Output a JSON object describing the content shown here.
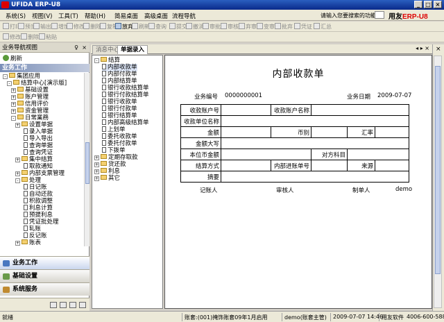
{
  "window": {
    "title": "UFIDA ERP-U8",
    "buttons": {
      "minimize": "_",
      "maximize": "□",
      "close": "×"
    }
  },
  "menubar": {
    "items": [
      "系统(S)",
      "视图(V)",
      "工具(T)",
      "帮助(H)",
      "简易桌面",
      "高级桌面",
      "流程导航"
    ],
    "search_hint": "请输入您要搜索的功能",
    "brand_prefix": "用友",
    "brand_suffix": "ERP-U8"
  },
  "toolbar1": {
    "items": [
      {
        "label": "打印",
        "on": false
      },
      {
        "label": "预览",
        "on": false
      },
      {
        "label": "输出",
        "on": false
      },
      {
        "label": "增加",
        "on": false
      },
      {
        "label": "修改",
        "on": false
      },
      {
        "label": "删除",
        "on": false
      },
      {
        "label": "复制",
        "on": false
      },
      {
        "label": "放弃",
        "on": true
      },
      {
        "label": "刷新",
        "on": false
      },
      {
        "label": "查询",
        "on": false
      },
      {
        "label": "提交",
        "on": false
      },
      {
        "label": "撤消",
        "on": false
      },
      {
        "label": "审批",
        "on": false
      },
      {
        "label": "审核",
        "on": false
      },
      {
        "label": "弃审",
        "on": false
      },
      {
        "label": "变审",
        "on": false
      },
      {
        "label": "批弃",
        "on": false
      },
      {
        "label": "凭证",
        "on": false
      },
      {
        "label": "汇总",
        "on": false
      }
    ]
  },
  "toolbar2": {
    "items": [
      {
        "label": "修改",
        "on": false
      },
      {
        "label": "删除",
        "on": false
      },
      {
        "label": "粘贴",
        "on": false
      }
    ]
  },
  "navpanel": {
    "header": "业务导航视图",
    "pin": "♀",
    "close": "×",
    "refresh_label": "刷新",
    "section_band": "业务工作",
    "tree": [
      {
        "label": "集团应用",
        "exp": "-",
        "fold": true
      },
      {
        "label": "结算中心[演示版]",
        "exp": "-",
        "fold": true
      },
      {
        "label": "基础设置",
        "exp": "+",
        "fold": true
      },
      {
        "label": "账户管理",
        "exp": "+",
        "fold": true
      },
      {
        "label": "信用评价",
        "exp": "+",
        "fold": true
      },
      {
        "label": "资金管理",
        "exp": "+",
        "fold": true
      },
      {
        "label": "日常業務",
        "exp": "-",
        "fold": true
      },
      {
        "label": "设置单据",
        "exp": "+",
        "fold": true
      },
      {
        "label": "录入单据",
        "exp": "",
        "fold": false
      },
      {
        "label": "导入导出",
        "exp": "",
        "fold": false
      },
      {
        "label": "查询单据",
        "exp": "",
        "fold": false
      },
      {
        "label": "查询凭证",
        "exp": "",
        "fold": false
      },
      {
        "label": "集中结算",
        "exp": "+",
        "fold": true
      },
      {
        "label": "取款通知",
        "exp": "",
        "fold": false
      },
      {
        "label": "内部支票管理",
        "exp": "+",
        "fold": true
      },
      {
        "label": "处理",
        "exp": "-",
        "fold": true
      },
      {
        "label": "日记账",
        "exp": "",
        "fold": false
      },
      {
        "label": "自动还款",
        "exp": "",
        "fold": false
      },
      {
        "label": "积款调整",
        "exp": "",
        "fold": false
      },
      {
        "label": "利息计算",
        "exp": "",
        "fold": false
      },
      {
        "label": "预提利息",
        "exp": "",
        "fold": false
      },
      {
        "label": "凭证批处理",
        "exp": "",
        "fold": false
      },
      {
        "label": "轧账",
        "exp": "",
        "fold": false
      },
      {
        "label": "反记账",
        "exp": "",
        "fold": false
      },
      {
        "label": "账表",
        "exp": "+",
        "fold": true
      }
    ],
    "bottom_buttons": [
      "业务工作",
      "基础设置",
      "系统服务"
    ]
  },
  "tabs": {
    "items": [
      "消息中心",
      "单据录入"
    ],
    "active": 1,
    "controls": "◂ ▸ ×"
  },
  "doctree": {
    "items": [
      {
        "label": "结算",
        "exp": "-",
        "fold": true,
        "sel": false
      },
      {
        "label": "内部收款单",
        "exp": "",
        "fold": false,
        "sel": true
      },
      {
        "label": "内部付款单",
        "exp": "",
        "fold": false,
        "sel": false
      },
      {
        "label": "内部结算单",
        "exp": "",
        "fold": false,
        "sel": false
      },
      {
        "label": "银行收款结算单",
        "exp": "",
        "fold": false,
        "sel": false
      },
      {
        "label": "银行付款结算单",
        "exp": "",
        "fold": false,
        "sel": false
      },
      {
        "label": "银行收款单",
        "exp": "",
        "fold": false,
        "sel": false
      },
      {
        "label": "银行付款单",
        "exp": "",
        "fold": false,
        "sel": false
      },
      {
        "label": "银行结算单",
        "exp": "",
        "fold": false,
        "sel": false
      },
      {
        "label": "内部高级结算单",
        "exp": "",
        "fold": false,
        "sel": false
      },
      {
        "label": "上划单",
        "exp": "",
        "fold": false,
        "sel": false
      },
      {
        "label": "委托收款单",
        "exp": "",
        "fold": false,
        "sel": false
      },
      {
        "label": "委托付款单",
        "exp": "",
        "fold": false,
        "sel": false
      },
      {
        "label": "下拨单",
        "exp": "",
        "fold": false,
        "sel": false
      },
      {
        "label": "定期存取款",
        "exp": "+",
        "fold": true,
        "sel": false
      },
      {
        "label": "贷还款",
        "exp": "+",
        "fold": true,
        "sel": false
      },
      {
        "label": "利息",
        "exp": "+",
        "fold": true,
        "sel": false
      },
      {
        "label": "其它",
        "exp": "+",
        "fold": true,
        "sel": false
      }
    ]
  },
  "voucher": {
    "title": "内部收款单",
    "doc_no_label": "业务编号",
    "doc_no_value": "0000000001",
    "date_label": "业务日期",
    "date_value": "2009-07-07",
    "fields": {
      "receive_account": "收款账户号",
      "receive_account_name": "收款账户名称",
      "pay_unit_name": "收款单位名称",
      "amount": "金额",
      "currency": "币别",
      "rate": "汇率",
      "amount_upper": "金额大写",
      "local_amount": "本位币金额",
      "counter_subject": "对方科目",
      "settle_method": "结算方式",
      "inner_account": "内部进账单号",
      "source": "来源",
      "summary": "摘要"
    },
    "signers": {
      "bookkeeper": "记账人",
      "auditor": "审核人",
      "maker": "制单人",
      "maker_value": "demo"
    }
  },
  "statusbar": {
    "ready": "就绪",
    "account": "账套:(001)掩饰账套09年1月启用",
    "user": "demo(账套主管)",
    "datetime": "2009-07-07 14:46",
    "company": "用友软件",
    "phone": "4006-600-588"
  }
}
